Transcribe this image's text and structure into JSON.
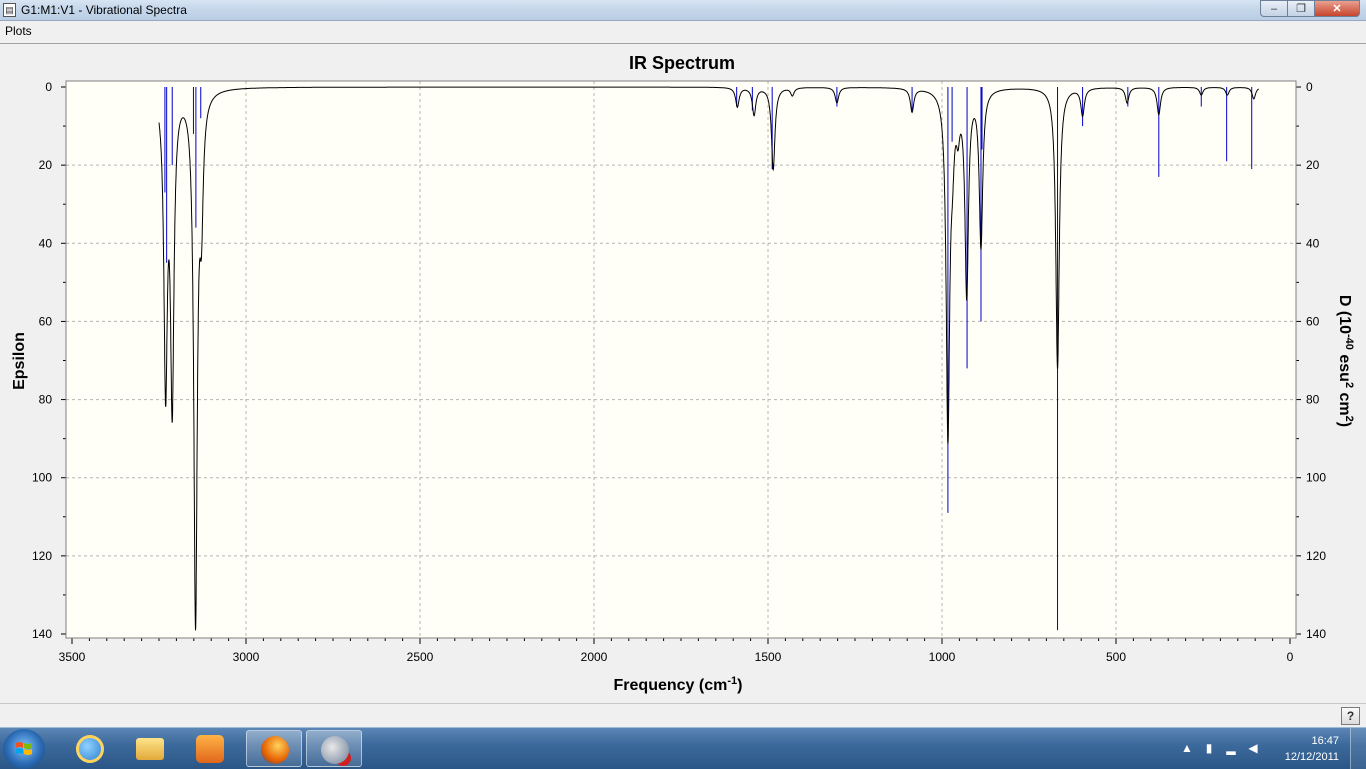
{
  "window": {
    "title": "G1:M1:V1 - Vibrational Spectra",
    "icon": "document-icon",
    "minimize_label": "‒",
    "maximize_label": "❐",
    "close_label": "✕"
  },
  "menu": {
    "items": [
      "Plots"
    ]
  },
  "help_button": "?",
  "taskbar": {
    "time": "16:47",
    "date": "12/12/2011",
    "icons": [
      "windows-start-icon",
      "internet-explorer-icon",
      "folder-icon",
      "media-player-icon",
      "firefox-icon",
      "gaussview-icon"
    ]
  },
  "colors": {
    "plot_bg": "#fffff7",
    "epsilon_line": "#000000",
    "stick_line": "#0000cc",
    "grid": "#b4b4b4"
  },
  "chart_data": {
    "type": "line",
    "title": "IR Spectrum",
    "xlabel": "Frequency (cm-1)",
    "ylabel": "Epsilon",
    "y2label": "D (10-40 esu2 cm2)",
    "xlim": [
      3500,
      0
    ],
    "ylim": [
      0,
      140
    ],
    "y2lim": [
      0,
      140
    ],
    "y_inverted": true,
    "x_reversed": true,
    "grid": true,
    "x_ticks": [
      3500,
      3000,
      2500,
      2000,
      1500,
      1000,
      500,
      0
    ],
    "y_ticks": [
      0,
      20,
      40,
      60,
      80,
      100,
      120,
      140
    ],
    "y2_ticks": [
      0,
      20,
      40,
      60,
      80,
      100,
      120,
      140
    ],
    "series": [
      {
        "kind": "epsilon",
        "peaks": [
          [
            3231,
            74
          ],
          [
            3212,
            78
          ],
          [
            3145,
            135
          ],
          [
            3128,
            28
          ],
          [
            1588,
            5
          ],
          [
            1540,
            7
          ],
          [
            1485,
            21
          ],
          [
            1430,
            2
          ],
          [
            1302,
            4
          ],
          [
            1086,
            6
          ],
          [
            983,
            88
          ],
          [
            970,
            12
          ],
          [
            954,
            8
          ],
          [
            929,
            52
          ],
          [
            888,
            40
          ],
          [
            668,
            72
          ],
          [
            596,
            7
          ],
          [
            468,
            4
          ],
          [
            377,
            7
          ],
          [
            255,
            2
          ],
          [
            180,
            2
          ],
          [
            104,
            3
          ]
        ]
      },
      {
        "kind": "stick",
        "sticks": [
          [
            3233,
            27
          ],
          [
            3228,
            45
          ],
          [
            3212,
            20
          ],
          [
            3151,
            12
          ],
          [
            3144,
            36
          ],
          [
            3130,
            8
          ],
          [
            1590,
            5
          ],
          [
            1545,
            6
          ],
          [
            1488,
            21
          ],
          [
            1302,
            5
          ],
          [
            1086,
            6
          ],
          [
            983,
            109
          ],
          [
            971,
            14
          ],
          [
            928,
            72
          ],
          [
            888,
            60
          ],
          [
            885,
            16
          ],
          [
            668,
            139
          ],
          [
            596,
            10
          ],
          [
            466,
            5
          ],
          [
            377,
            23
          ],
          [
            255,
            5
          ],
          [
            182,
            19
          ],
          [
            110,
            21
          ]
        ]
      }
    ]
  }
}
